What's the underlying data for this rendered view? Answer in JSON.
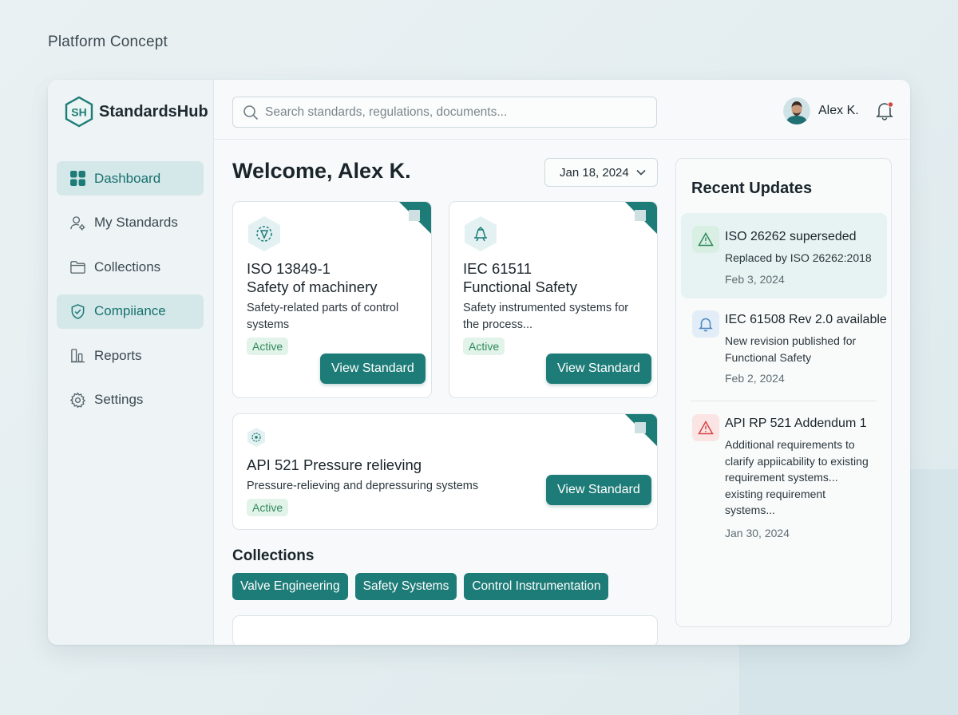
{
  "page": {
    "caption": "Platform Concept"
  },
  "brand": {
    "logo_text": "SH",
    "name": "StandardsHub"
  },
  "colors": {
    "accent": "#1e7c78",
    "active_bg": "#d4e7e9",
    "badge_bg": "#e2f3ea",
    "badge_text": "#2f8a5a",
    "warning": "#d64545"
  },
  "sidebar": {
    "items": [
      {
        "label": "Dashboard",
        "icon": "grid-icon",
        "active": true
      },
      {
        "label": "My Standards",
        "icon": "users-gear-icon",
        "active": false
      },
      {
        "label": "Collections",
        "icon": "folder-icon",
        "active": false
      },
      {
        "label": "Compiiance",
        "icon": "shield-check-icon",
        "active": true
      },
      {
        "label": "Reports",
        "icon": "bar-chart-icon",
        "active": false
      },
      {
        "label": "Settings",
        "icon": "gear-icon",
        "active": false
      }
    ]
  },
  "topbar": {
    "search": {
      "placeholder": "Search standards, regulations, documents..."
    },
    "user": {
      "name": "Alex K."
    },
    "notifications": {
      "has_unread": true
    }
  },
  "main": {
    "welcome": "Welcome, Alex K.",
    "date_filter": "Jan 18, 2024",
    "cards": [
      {
        "code": "ISO 13849-1",
        "title": "Safety of machinery",
        "description": "Safety-related parts of control systems",
        "status": "Active",
        "button": "View Standard"
      },
      {
        "code": "IEC 61511",
        "title": "Functional Safety",
        "description": "Safety instrumented systems for the process...",
        "status": "Active",
        "button": "View Standard"
      },
      {
        "title": "API 521 Pressure relieving",
        "description": "Pressure-relieving and depressuring systems",
        "status": "Active",
        "button": "View Standard"
      }
    ],
    "collections": {
      "title": "Collections",
      "chips": [
        "Valve Engineering",
        "Safety Systems",
        "Control Instrumentation"
      ]
    }
  },
  "updates": {
    "title": "Recent Updates",
    "items": [
      {
        "title": "ISO 26262 superseded",
        "description": "Replaced by ISO 26262:2018",
        "date": "Feb 3, 2024",
        "icon": "warning-triangle-icon"
      },
      {
        "title": "IEC 61508 Rev 2.0 available",
        "description": "New revision published for Functional Safety",
        "date": "Feb 2, 2024",
        "icon": "bell-icon"
      },
      {
        "title": "API RP 521 Addendum 1",
        "description": "Additional requirements to clarify appiicability to existing requirement systems... existing requirement systems...",
        "date": "Jan 30, 2024",
        "icon": "alert-triangle-icon"
      }
    ]
  }
}
